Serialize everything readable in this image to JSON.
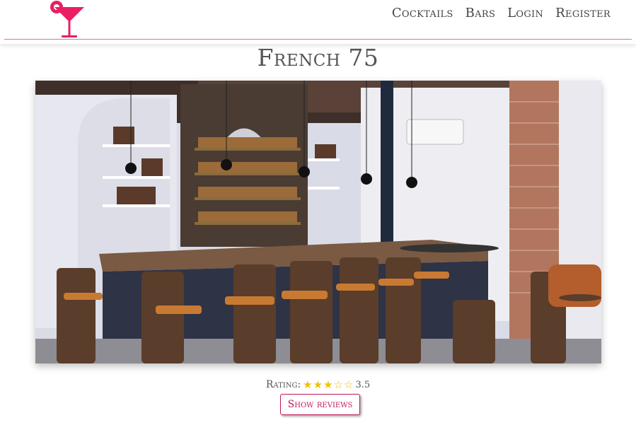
{
  "nav": {
    "items": [
      {
        "label": "Cocktails"
      },
      {
        "label": "Bars"
      },
      {
        "label": "Login"
      },
      {
        "label": "Register"
      }
    ]
  },
  "page": {
    "title": "French 75",
    "image_icon": "bar-interior-photo"
  },
  "rating": {
    "label": "Rating:",
    "value_text": "3.5",
    "value": 3.5,
    "max": 5
  },
  "reviews_button": {
    "label": "Show reviews"
  },
  "colors": {
    "accent": "#c2185b",
    "logo": "#e91e63",
    "star": "#f2c100"
  }
}
